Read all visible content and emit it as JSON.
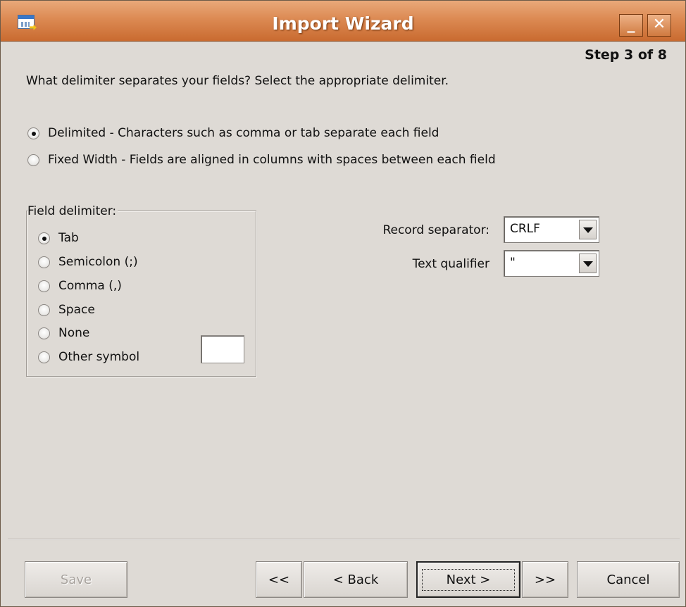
{
  "window": {
    "title": "Import Wizard",
    "minimize_label": "_",
    "close_label": "✕"
  },
  "step": "Step 3 of 8",
  "question": "What delimiter separates your fields? Select the appropriate delimiter.",
  "format_options": [
    {
      "label": "Delimited - Characters such as comma or tab separate each field",
      "selected": true
    },
    {
      "label": "Fixed Width - Fields are aligned in columns with spaces between each field",
      "selected": false
    }
  ],
  "field_delimiter": {
    "legend": "Field delimiter:",
    "options": [
      {
        "label": "Tab",
        "selected": true
      },
      {
        "label": "Semicolon (;)",
        "selected": false
      },
      {
        "label": "Comma (,)",
        "selected": false
      },
      {
        "label": "Space",
        "selected": false
      },
      {
        "label": "None",
        "selected": false
      },
      {
        "label": "Other symbol",
        "selected": false
      }
    ],
    "other_value": ""
  },
  "record_separator": {
    "label": "Record separator:",
    "value": "CRLF"
  },
  "text_qualifier": {
    "label": "Text qualifier",
    "value": "\""
  },
  "buttons": {
    "save": "Save",
    "first": "<<",
    "back": "< Back",
    "next": "Next >",
    "last": ">>",
    "cancel": "Cancel"
  },
  "colors": {
    "titlebar": "#dc8a53",
    "window_bg": "#dedad5"
  }
}
